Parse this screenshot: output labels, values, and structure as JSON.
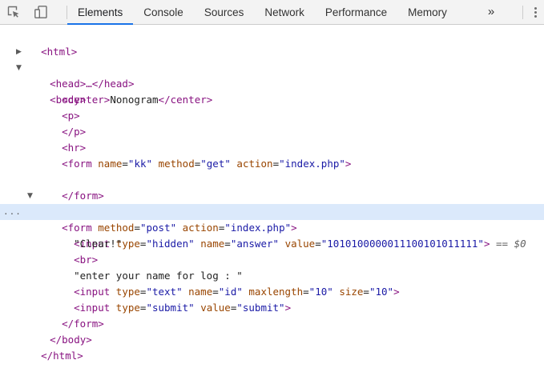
{
  "tabs": [
    "Elements",
    "Console",
    "Sources",
    "Network",
    "Performance",
    "Memory"
  ],
  "more_tabs": "»",
  "dom": {
    "html_open": "<html>",
    "head_collapsed": "<head>…</head>",
    "body_open": "<body>",
    "center": {
      "open": "<center>",
      "text": "Nonogram",
      "close": "</center>"
    },
    "p_open": "<p>",
    "p_close": "</p>",
    "hr": "<hr>",
    "form1": {
      "open": "<form",
      "attrs": [
        {
          "name": "name",
          "value": "\"kk\""
        },
        {
          "name": "method",
          "value": "\"get\""
        },
        {
          "name": "action",
          "value": "\"index.php\""
        }
      ],
      "end": ">",
      "close": "</form>"
    },
    "form2": {
      "open": "<form",
      "attrs": [
        {
          "name": "method",
          "value": "\"post\""
        },
        {
          "name": "action",
          "value": "\"index.php\""
        }
      ],
      "end": ">",
      "close": "</form>"
    },
    "input_hidden": {
      "open": "<input",
      "attrs": [
        {
          "name": "type",
          "value": "\"hidden\""
        },
        {
          "name": "name",
          "value": "\"answer\""
        },
        {
          "name": "value",
          "value": "\"1010100000011100101011111\""
        }
      ],
      "end": ">",
      "selected_marker": "== $0"
    },
    "text_clear": "\"Clear!\"",
    "br": "<br>",
    "text_enter": "\"enter your name for log : \"",
    "input_text": {
      "open": "<input",
      "attrs": [
        {
          "name": "type",
          "value": "\"text\""
        },
        {
          "name": "name",
          "value": "\"id\""
        },
        {
          "name": "maxlength",
          "value": "\"10\""
        },
        {
          "name": "size",
          "value": "\"10\""
        }
      ],
      "end": ">"
    },
    "input_submit": {
      "open": "<input",
      "attrs": [
        {
          "name": "type",
          "value": "\"submit\""
        },
        {
          "name": "value",
          "value": "\"submit\""
        }
      ],
      "end": ">"
    },
    "body_close": "</body>",
    "html_close": "</html>",
    "ellipsis": "..."
  }
}
